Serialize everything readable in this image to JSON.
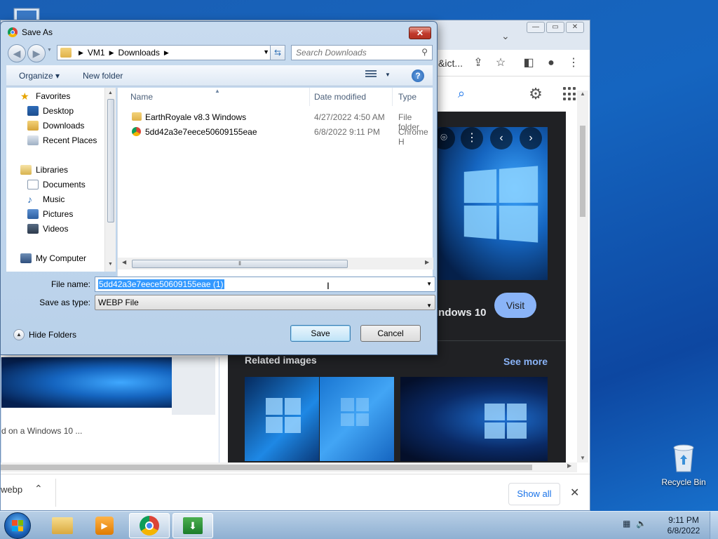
{
  "colors": {
    "dialog_frame": "#b9d1ea",
    "selection": "#3399ff",
    "link_blue": "#8ab4f8",
    "desktop": "#1565c0"
  },
  "chrome": {
    "omnibox_fragment": "&ict...",
    "knowledge_panel": {
      "title_fragment": "indows 10",
      "visit_label": "Visit",
      "related_heading": "Related images",
      "see_more": "See more"
    },
    "left_caption": "d on a Windows 10 ...",
    "download": {
      "filename_fragment": "webp",
      "show_all": "Show all"
    }
  },
  "dialog": {
    "title": "Save As",
    "close_glyph": "✕",
    "breadcrumb": [
      "VM1",
      "Downloads"
    ],
    "search_placeholder": "Search Downloads",
    "commands": {
      "organize": "Organize",
      "new_folder": "New folder"
    },
    "nav_pane": {
      "favorites": "Favorites",
      "favorites_items": [
        "Desktop",
        "Downloads",
        "Recent Places"
      ],
      "libraries": "Libraries",
      "library_items": [
        "Documents",
        "Music",
        "Pictures",
        "Videos"
      ],
      "computer": "My Computer"
    },
    "columns": {
      "name": "Name",
      "date": "Date modified",
      "type": "Type"
    },
    "files": [
      {
        "name": "EarthRoyale v8.3 Windows",
        "date": "4/27/2022 4:50 AM",
        "type": "File folder",
        "icon": "folder-icon"
      },
      {
        "name": "5dd42a3e7eece50609155eae",
        "date": "6/8/2022 9:11 PM",
        "type": "Chrome H",
        "icon": "chrome-html-icon"
      }
    ],
    "file_name_label": "File name:",
    "file_name_value": "5dd42a3e7eece50609155eae (1)",
    "save_type_label": "Save as type:",
    "save_type_value": "WEBP File",
    "hide_folders": "Hide Folders",
    "save_button": "Save",
    "cancel_button": "Cancel"
  },
  "desktop": {
    "recycle_bin": "Recycle Bin"
  },
  "taskbar": {
    "time": "9:11 PM",
    "date": "6/8/2022"
  }
}
